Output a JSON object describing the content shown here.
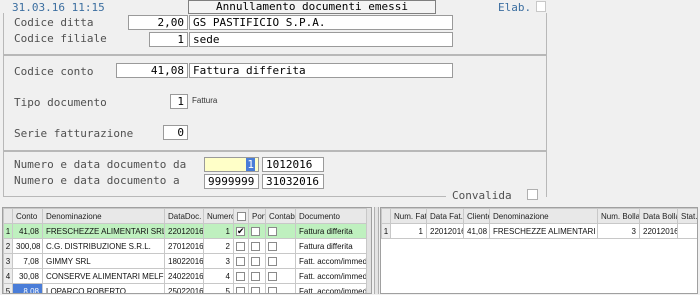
{
  "header": {
    "datetime": "31.03.16 11:15",
    "title": "Annullamento documenti emessi",
    "mode": "Elab."
  },
  "form": {
    "ditta": {
      "label": "Codice ditta",
      "code": "2,00",
      "name": "GS PASTIFICIO S.P.A."
    },
    "filiale": {
      "label": "Codice filiale",
      "code": "1",
      "name": "sede"
    },
    "conto": {
      "label": "Codice conto",
      "code": "41,08",
      "name": "Fattura differita"
    },
    "tipo": {
      "label": "Tipo documento",
      "code": "1",
      "name": "Fattura"
    },
    "serie": {
      "label": "Serie fatturazione",
      "code": "0"
    },
    "da": {
      "label": "Numero e data documento da",
      "number": "1",
      "date": "1012016"
    },
    "a": {
      "label": "Numero e data documento  a",
      "number": "9999999",
      "date": "31032016"
    },
    "validate_label": "Convalida"
  },
  "left_table": {
    "columns": [
      "Conto",
      "Denominazione",
      "DataDoc.",
      "Numero",
      "",
      "Port.",
      "Contab.",
      "Documento"
    ],
    "rows": [
      {
        "idx": "1",
        "conto": "41,08",
        "denominazione": "FRESCHEZZE ALIMENTARI SRL",
        "data": "22012016",
        "numero": "1",
        "checked": "✔",
        "documento": "Fattura differita"
      },
      {
        "idx": "2",
        "conto": "300,08",
        "denominazione": "C.G. DISTRIBUZIONE S.R.L.",
        "data": "27012016",
        "numero": "2",
        "checked": "",
        "documento": "Fattura differita"
      },
      {
        "idx": "3",
        "conto": "7,08",
        "denominazione": "GIMMY SRL",
        "data": "18022016",
        "numero": "3",
        "checked": "",
        "documento": "Fatt. accom/immed."
      },
      {
        "idx": "4",
        "conto": "30,08",
        "denominazione": "CONSERVE ALIMENTARI MELFI SRL",
        "data": "24022016",
        "numero": "4",
        "checked": "",
        "documento": "Fatt. accom/immed."
      },
      {
        "idx": "5",
        "conto": "8,08",
        "denominazione": "LOPARCO ROBERTO",
        "data": "25022016",
        "numero": "5",
        "checked": "",
        "documento": "Fatt. accom/immed."
      }
    ]
  },
  "right_table": {
    "columns": [
      "Num. Fat.",
      "Data Fat.",
      "Cliente",
      "Denominazione",
      "Num. Bolla",
      "Data Bolla",
      "Stat."
    ],
    "rows": [
      {
        "idx": "1",
        "num_fat": "1",
        "data_fat": "22012016",
        "cliente": "41,08",
        "denominazione": "FRESCHEZZE ALIMENTARI SRL",
        "num_bolla": "3",
        "data_bolla": "22012016",
        "stat": ""
      }
    ]
  }
}
